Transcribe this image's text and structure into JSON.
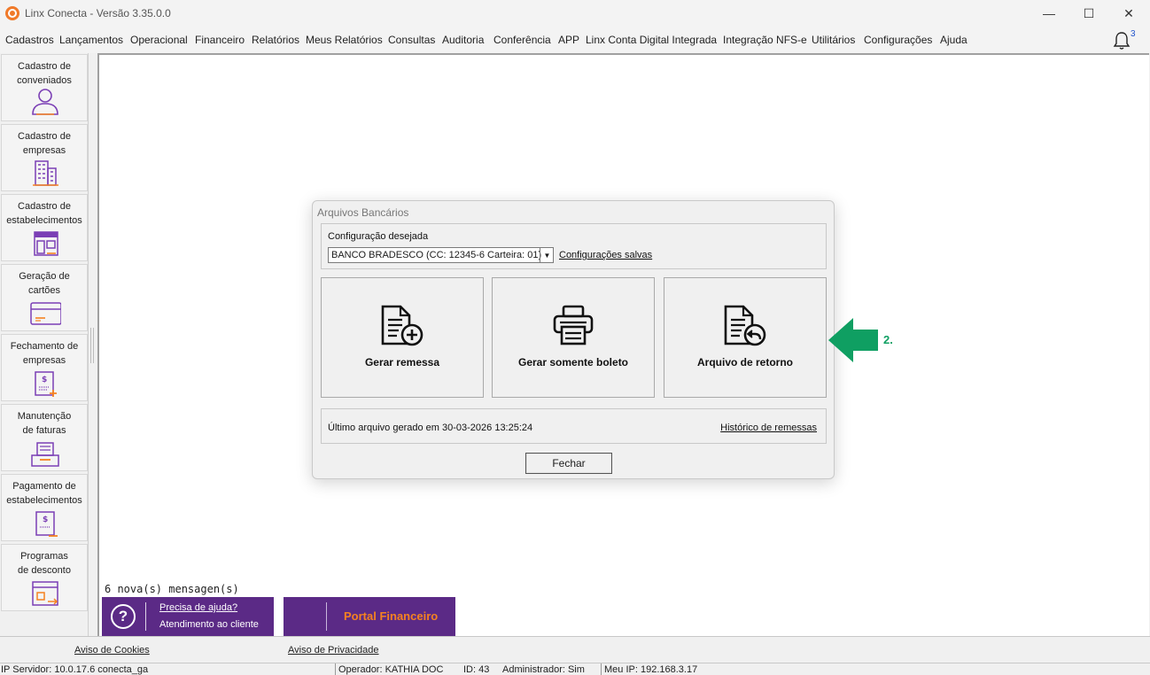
{
  "window": {
    "title": "Linx Conecta - Versão 3.35.0.0",
    "minimize": "—",
    "maximize": "☐",
    "close": "✕"
  },
  "menu": {
    "items": [
      "Cadastros",
      "Lançamentos",
      "Operacional",
      "Financeiro",
      "Relatórios",
      "Meus Relatórios",
      "Consultas",
      "Auditoria",
      "Conferência",
      "APP",
      "Linx Conta Digital Integrada",
      "Integração NFS-e",
      "Utilitários",
      "Configurações",
      "Ajuda"
    ],
    "notification_count": "3"
  },
  "sidebar": {
    "items": [
      {
        "label": "Cadastro de\nconveniados",
        "icon": "user-icon"
      },
      {
        "label": "Cadastro de\nempresas",
        "icon": "building-icon"
      },
      {
        "label": "Cadastro de\nestabelecimentos",
        "icon": "store-icon"
      },
      {
        "label": "Geração de\ncartões",
        "icon": "card-icon"
      },
      {
        "label": "Fechamento de\nempresas",
        "icon": "invoice-add-icon"
      },
      {
        "label": "Manutenção\nde faturas",
        "icon": "tray-icon"
      },
      {
        "label": "Pagamento de\nestabelecimentos",
        "icon": "payment-icon"
      },
      {
        "label": "Programas\nde desconto",
        "icon": "discount-icon"
      }
    ]
  },
  "main": {
    "messages": "6 nova(s) mensagen(s)",
    "help_line1": "Precisa de ajuda?",
    "help_line2": "Atendimento ao cliente",
    "help_icon": "?",
    "portal": "Portal Financeiro"
  },
  "dialog": {
    "title": "Arquivos Bancários",
    "config_label": "Configuração desejada",
    "config_value": "BANCO BRADESCO (CC: 12345-6 Carteira: 01)",
    "saved_link": "Configurações salvas",
    "buttons": [
      {
        "label": "Gerar remessa",
        "icon": "document-add-icon"
      },
      {
        "label": "Gerar somente boleto",
        "icon": "printer-icon"
      },
      {
        "label": "Arquivo de retorno",
        "icon": "document-return-icon"
      }
    ],
    "last_file": "Último arquivo gerado em 30-03-2026 13:25:24",
    "history_link": "Histórico de remessas",
    "close_label": "Fechar"
  },
  "annotation": {
    "label": "2.",
    "color": "#0f9f62"
  },
  "footer": {
    "cookies": "Aviso de Cookies",
    "privacy": "Aviso de Privacidade"
  },
  "status": {
    "server": "IP Servidor: 10.0.17.6 conecta_ga",
    "operator": "Operador: KATHIA DOC",
    "id": "ID: 43",
    "admin": "Administrador: Sim",
    "my_ip": "Meu IP: 192.168.3.17"
  },
  "colors": {
    "brand_purple": "#5b2a86",
    "brand_orange": "#f58220",
    "icon_purple": "#7b3fb5"
  }
}
